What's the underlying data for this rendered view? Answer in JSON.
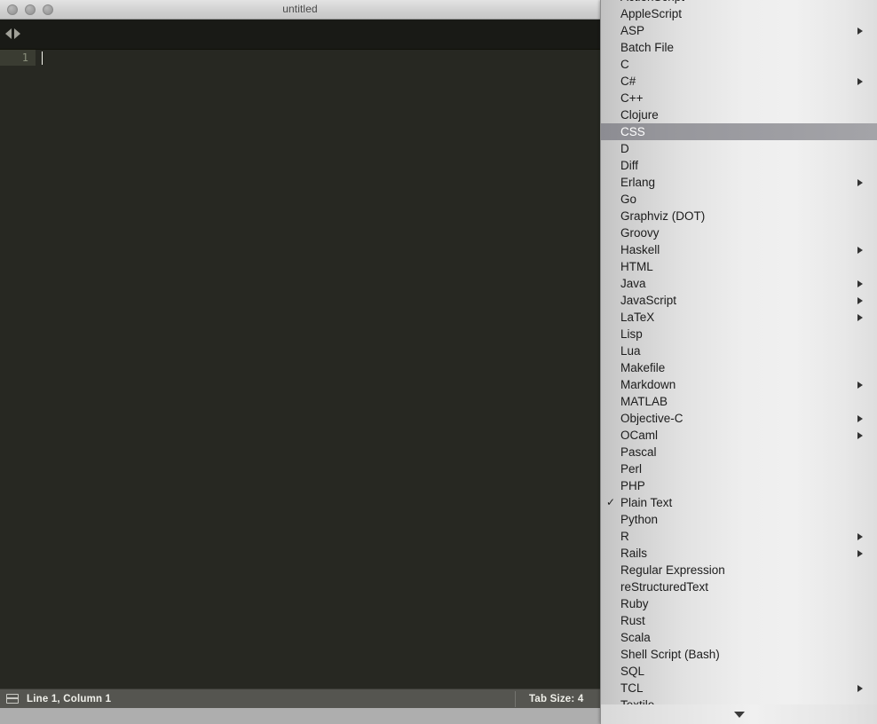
{
  "window": {
    "title": "untitled",
    "traffic_lights": [
      "close-button",
      "minimize-button",
      "zoom-button"
    ],
    "tab_nav": {
      "back": "nav-back-arrow",
      "forward": "nav-forward-arrow"
    }
  },
  "editor": {
    "line_numbers": [
      "1"
    ],
    "content": ""
  },
  "status_bar": {
    "panel_icon": "panel-toggle-icon",
    "position": "Line 1, Column 1",
    "tab_size": "Tab Size: 4"
  },
  "syntax_menu": {
    "selected": "CSS",
    "checked": "Plain Text",
    "scroll_down_indicator": "chevron-down-icon",
    "items": [
      {
        "label": "ActionScript",
        "submenu": false,
        "checked": false,
        "selected": false,
        "clipped": true
      },
      {
        "label": "AppleScript",
        "submenu": false,
        "checked": false,
        "selected": false
      },
      {
        "label": "ASP",
        "submenu": true,
        "checked": false,
        "selected": false
      },
      {
        "label": "Batch File",
        "submenu": false,
        "checked": false,
        "selected": false
      },
      {
        "label": "C",
        "submenu": false,
        "checked": false,
        "selected": false
      },
      {
        "label": "C#",
        "submenu": true,
        "checked": false,
        "selected": false
      },
      {
        "label": "C++",
        "submenu": false,
        "checked": false,
        "selected": false
      },
      {
        "label": "Clojure",
        "submenu": false,
        "checked": false,
        "selected": false
      },
      {
        "label": "CSS",
        "submenu": false,
        "checked": false,
        "selected": true
      },
      {
        "label": "D",
        "submenu": false,
        "checked": false,
        "selected": false
      },
      {
        "label": "Diff",
        "submenu": false,
        "checked": false,
        "selected": false
      },
      {
        "label": "Erlang",
        "submenu": true,
        "checked": false,
        "selected": false
      },
      {
        "label": "Go",
        "submenu": false,
        "checked": false,
        "selected": false
      },
      {
        "label": "Graphviz (DOT)",
        "submenu": false,
        "checked": false,
        "selected": false
      },
      {
        "label": "Groovy",
        "submenu": false,
        "checked": false,
        "selected": false
      },
      {
        "label": "Haskell",
        "submenu": true,
        "checked": false,
        "selected": false
      },
      {
        "label": "HTML",
        "submenu": false,
        "checked": false,
        "selected": false
      },
      {
        "label": "Java",
        "submenu": true,
        "checked": false,
        "selected": false
      },
      {
        "label": "JavaScript",
        "submenu": true,
        "checked": false,
        "selected": false
      },
      {
        "label": "LaTeX",
        "submenu": true,
        "checked": false,
        "selected": false
      },
      {
        "label": "Lisp",
        "submenu": false,
        "checked": false,
        "selected": false
      },
      {
        "label": "Lua",
        "submenu": false,
        "checked": false,
        "selected": false
      },
      {
        "label": "Makefile",
        "submenu": false,
        "checked": false,
        "selected": false
      },
      {
        "label": "Markdown",
        "submenu": true,
        "checked": false,
        "selected": false
      },
      {
        "label": "MATLAB",
        "submenu": false,
        "checked": false,
        "selected": false
      },
      {
        "label": "Objective-C",
        "submenu": true,
        "checked": false,
        "selected": false
      },
      {
        "label": "OCaml",
        "submenu": true,
        "checked": false,
        "selected": false
      },
      {
        "label": "Pascal",
        "submenu": false,
        "checked": false,
        "selected": false
      },
      {
        "label": "Perl",
        "submenu": false,
        "checked": false,
        "selected": false
      },
      {
        "label": "PHP",
        "submenu": false,
        "checked": false,
        "selected": false
      },
      {
        "label": "Plain Text",
        "submenu": false,
        "checked": true,
        "selected": false
      },
      {
        "label": "Python",
        "submenu": false,
        "checked": false,
        "selected": false
      },
      {
        "label": "R",
        "submenu": true,
        "checked": false,
        "selected": false
      },
      {
        "label": "Rails",
        "submenu": true,
        "checked": false,
        "selected": false
      },
      {
        "label": "Regular Expression",
        "submenu": false,
        "checked": false,
        "selected": false
      },
      {
        "label": "reStructuredText",
        "submenu": false,
        "checked": false,
        "selected": false
      },
      {
        "label": "Ruby",
        "submenu": false,
        "checked": false,
        "selected": false
      },
      {
        "label": "Rust",
        "submenu": false,
        "checked": false,
        "selected": false
      },
      {
        "label": "Scala",
        "submenu": false,
        "checked": false,
        "selected": false
      },
      {
        "label": "Shell Script (Bash)",
        "submenu": false,
        "checked": false,
        "selected": false
      },
      {
        "label": "SQL",
        "submenu": false,
        "checked": false,
        "selected": false
      },
      {
        "label": "TCL",
        "submenu": true,
        "checked": false,
        "selected": false
      },
      {
        "label": "Textile",
        "submenu": false,
        "checked": false,
        "selected": false,
        "clipped": true
      }
    ]
  },
  "colors": {
    "editor_background": "#272822",
    "menu_highlight": "#97979c",
    "status_bar": "#555550"
  }
}
